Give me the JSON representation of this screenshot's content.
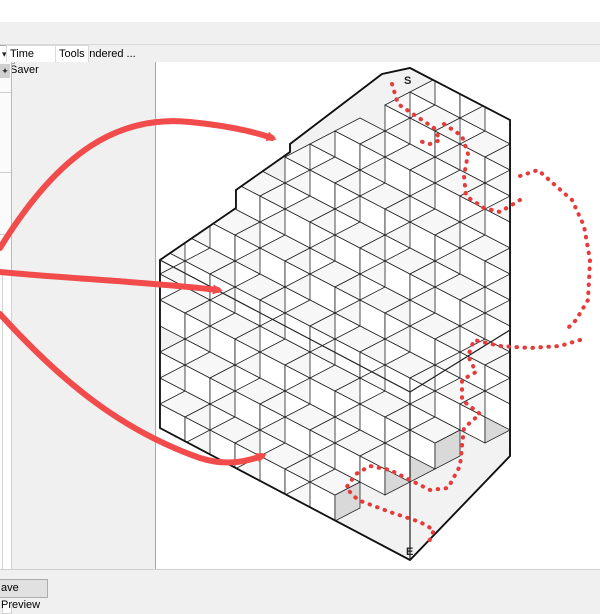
{
  "toolbar": {
    "preview_label": "Preview Rendered ..."
  },
  "tabs": [
    {
      "label": "Time Saver"
    },
    {
      "label": "Tools"
    }
  ],
  "maze": {
    "start_label": "S",
    "end_label": "E"
  },
  "footer": {
    "save_preview_label": "ave Preview"
  },
  "colors": {
    "arrow": "#f14b4b",
    "path_dots": "#e53b3b",
    "cube_top": "#f7f7f7",
    "cube_side": "#d9d9d9"
  }
}
